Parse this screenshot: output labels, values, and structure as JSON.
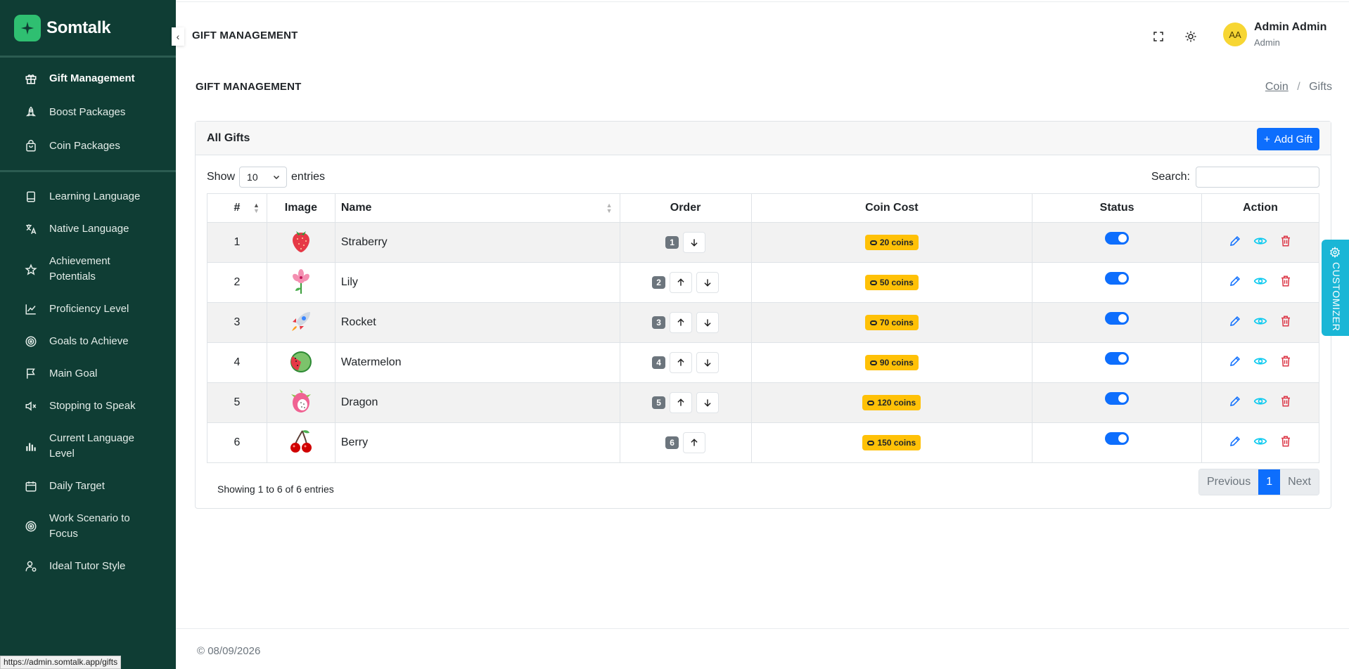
{
  "brand": {
    "name": "Somtalk"
  },
  "sidebar": {
    "primary": [
      {
        "label": "Gift Management",
        "icon": "gift-icon",
        "active": true
      },
      {
        "label": "Boost Packages",
        "icon": "rocket-icon"
      },
      {
        "label": "Coin Packages",
        "icon": "shopping-bag-icon"
      }
    ],
    "secondary": [
      {
        "label": "Learning Language",
        "icon": "book-icon"
      },
      {
        "label": "Native Language",
        "icon": "translate-icon"
      },
      {
        "label": "Achievement Potentials",
        "icon": "star-icon"
      },
      {
        "label": "Proficiency Level",
        "icon": "line-chart-icon"
      },
      {
        "label": "Goals to Achieve",
        "icon": "target-icon"
      },
      {
        "label": "Main Goal",
        "icon": "flag-icon"
      },
      {
        "label": "Stopping to Speak",
        "icon": "mute-icon"
      },
      {
        "label": "Current Language Level",
        "icon": "bar-chart-icon"
      },
      {
        "label": "Daily Target",
        "icon": "calendar-icon"
      },
      {
        "label": "Work Scenario to Focus",
        "icon": "target-icon"
      },
      {
        "label": "Ideal Tutor Style",
        "icon": "user-settings-icon"
      }
    ]
  },
  "topbar": {
    "title": "GIFT MANAGEMENT",
    "user": {
      "initials": "AA",
      "name": "Admin Admin",
      "role": "Admin"
    }
  },
  "page": {
    "title": "GIFT MANAGEMENT",
    "breadcrumb": {
      "parent": "Coin",
      "separator": "/",
      "current": "Gifts"
    }
  },
  "card": {
    "title": "All Gifts",
    "add_button": "Add Gift",
    "show_label": "Show",
    "entries_value": "10",
    "entries_label": "entries",
    "search_label": "Search:",
    "search_value": ""
  },
  "table": {
    "columns": [
      "#",
      "Image",
      "Name",
      "Order",
      "Coin Cost",
      "Status",
      "Action"
    ],
    "rows": [
      {
        "num": "1",
        "name": "Straberry",
        "order": "1",
        "coins": "20 coins",
        "image": "strawberry",
        "up": false,
        "down": true,
        "enabled": true
      },
      {
        "num": "2",
        "name": "Lily",
        "order": "2",
        "coins": "50 coins",
        "image": "lily",
        "up": true,
        "down": true,
        "enabled": true
      },
      {
        "num": "3",
        "name": "Rocket",
        "order": "3",
        "coins": "70 coins",
        "image": "rocket",
        "up": true,
        "down": true,
        "enabled": true
      },
      {
        "num": "4",
        "name": "Watermelon",
        "order": "4",
        "coins": "90 coins",
        "image": "watermelon",
        "up": true,
        "down": true,
        "enabled": true
      },
      {
        "num": "5",
        "name": "Dragon",
        "order": "5",
        "coins": "120 coins",
        "image": "dragonfruit",
        "up": true,
        "down": true,
        "enabled": true
      },
      {
        "num": "6",
        "name": "Berry",
        "order": "6",
        "coins": "150 coins",
        "image": "cherry",
        "up": true,
        "down": false,
        "enabled": true
      }
    ],
    "info": "Showing 1 to 6 of 6 entries"
  },
  "pagination": {
    "previous": "Previous",
    "current": "1",
    "next": "Next"
  },
  "customizer": {
    "label": "CUSTOMIZER"
  },
  "footer": {
    "text": "© 08/09/2026"
  },
  "status_bar": {
    "url": "https://admin.somtalk.app/gifts"
  },
  "colors": {
    "sidebar": "#0f3d34",
    "primary": "#0d6efd",
    "coin": "#ffc107",
    "danger": "#dc3545",
    "info": "#0dcaf0",
    "customizer": "#1ab6d6"
  }
}
